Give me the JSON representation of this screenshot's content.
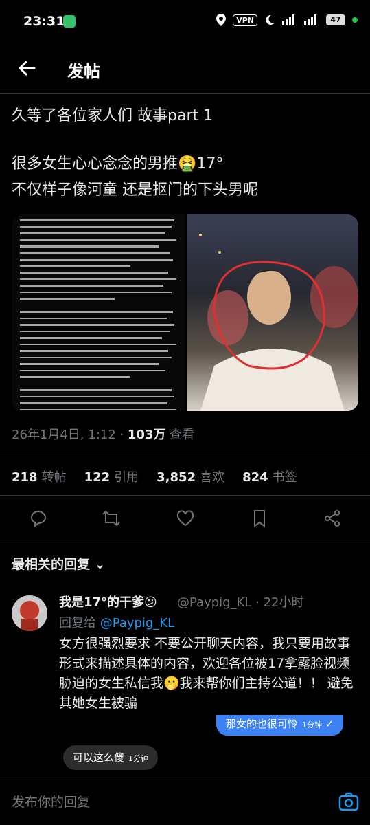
{
  "status_bar": {
    "time": "23:31",
    "vpn": "VPN",
    "battery": "47"
  },
  "header": {
    "title": "发帖"
  },
  "post": {
    "line1": "久等了各位家人们 故事part 1",
    "line2": "很多女生心心念念的男推🤮17°",
    "line3": "不仅样子像河童 还是抠门的下头男呢",
    "timestamp": "26年1月4日, 1:12 · ",
    "views": "103万",
    "views_label": " 查看"
  },
  "stats": {
    "reposts": "218",
    "reposts_label": "转帖",
    "quotes": "122",
    "quotes_label": "引用",
    "likes": "3,852",
    "likes_label": "喜欢",
    "bookmarks": "824",
    "bookmarks_label": "书签"
  },
  "actions": [
    "reply-icon",
    "repost-icon",
    "like-icon",
    "bookmark-icon",
    "share-icon"
  ],
  "replies_section": {
    "label": "最相关的回复"
  },
  "reply": {
    "name": "我是17°的干爹😕",
    "handle": "@Paypig_KL · 22小时",
    "reply_to_prefix": "回复给 ",
    "reply_to_handle": "@Paypig_KL",
    "body": "女方很强烈要求 不要公开聊天内容，我只要用故事形式来描述具体的内容，欢迎各位被17拿露脸视频胁迫的女生私信我🫢我来帮你们主持公道！！ 避免其她女生被骗"
  },
  "bubbles": [
    {
      "text": "那女的也很可怜",
      "time": "1分钟"
    },
    {
      "text": "可以这么傻",
      "time": "1分钟"
    }
  ],
  "composer": {
    "placeholder": "发布你的回复"
  },
  "colors": {
    "accent": "#1d9bf0",
    "muted": "#71767b"
  }
}
